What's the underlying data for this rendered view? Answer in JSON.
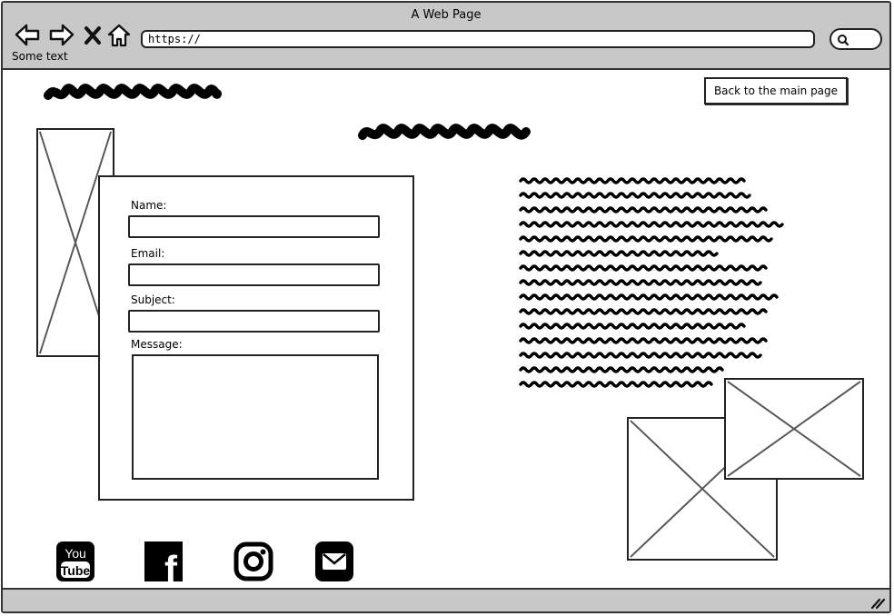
{
  "window": {
    "title": "A Web Page"
  },
  "toolbar": {
    "url": "https://",
    "chrome_text": "Some text",
    "icons": [
      "back-arrow-icon",
      "forward-arrow-icon",
      "close-x-icon",
      "home-icon",
      "search-icon"
    ]
  },
  "page": {
    "back_button_label": "Back to the main page"
  },
  "form": {
    "name_label": "Name:",
    "email_label": "Email:",
    "subject_label": "Subject:",
    "message_label": "Message:"
  },
  "social": {
    "youtube": {
      "icon": "youtube-icon",
      "text_top": "You",
      "text_bottom": "Tube"
    },
    "facebook": {
      "icon": "facebook-icon",
      "glyph": "f"
    },
    "instagram": {
      "icon": "instagram-icon"
    },
    "email": {
      "icon": "email-icon"
    }
  }
}
